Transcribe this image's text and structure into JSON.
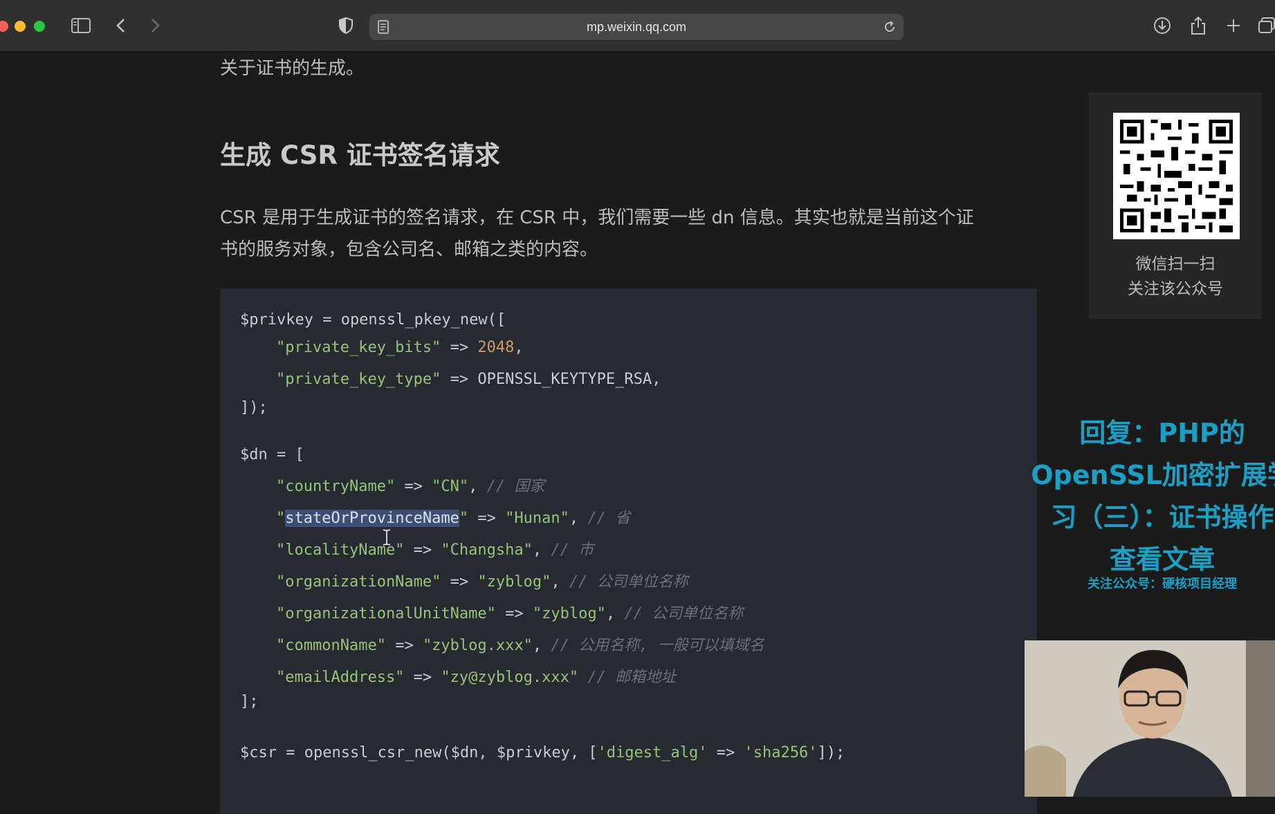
{
  "browser": {
    "url": "mp.weixin.qq.com",
    "colors": {
      "close": "#ff5f57",
      "minimize": "#febc2e",
      "maximize": "#28c840"
    }
  },
  "article": {
    "intro": "关于证书的生成。",
    "heading": "生成 CSR 证书签名请求",
    "para_line1": "CSR 是用于生成证书的签名请求，在 CSR 中，我们需要一些 dn 信息。其实也就是当前这个证",
    "para_line2": "书的服务对象，包含公司名、邮箱之类的内容。"
  },
  "code": {
    "l1": "$privkey = openssl_pkey_new([",
    "l2_key": "\"private_key_bits\"",
    "arrow": " => ",
    "l2_val": "2048",
    "comma": ",",
    "l3_key": "\"private_key_type\"",
    "l3_val": "OPENSSL_KEYTYPE_RSA,",
    "l4": "]);",
    "l5": "$dn = [",
    "l6_key": "\"countryName\"",
    "l6_val": "\"CN\"",
    "l6_cmt": "// 国家",
    "quote": "\"",
    "l7_hl": "stateOrProvinceName",
    "l7_val": "\"Hunan\"",
    "l7_cmt": "// 省",
    "l8_key": "\"localityName\"",
    "l8_val": "\"Changsha\"",
    "l8_cmt": "// 市",
    "l9_key": "\"organizationName\"",
    "l9_val": "\"zyblog\"",
    "l9_cmt": "// 公司单位名称",
    "l10_key": "\"organizationalUnitName\"",
    "l10_val": "\"zyblog\"",
    "l10_cmt": "// 公司单位名称",
    "l11_key": "\"commonName\"",
    "l11_val": "\"zyblog.xxx\"",
    "l11_cmt": "// 公用名称, 一般可以填域名",
    "l12_key": "\"emailAddress\"",
    "l12_val": "\"zy@zyblog.xxx\"",
    "l12_cmt": "// 邮箱地址",
    "l13": "];",
    "l14_a": "$csr = openssl_csr_new($dn, $privkey, [",
    "l14_k": "'digest_alg'",
    "l14_v": "'sha256'",
    "l14_b": "]);"
  },
  "sidebar": {
    "qr_caption1": "微信扫一扫",
    "qr_caption2": "关注该公众号"
  },
  "overlay": {
    "line1": "回复：PHP的",
    "line2": "OpenSSL加密扩展学",
    "line3": "习（三）：证书操作",
    "line4": "查看文章",
    "sub": "关注公众号：硬核项目经理"
  }
}
